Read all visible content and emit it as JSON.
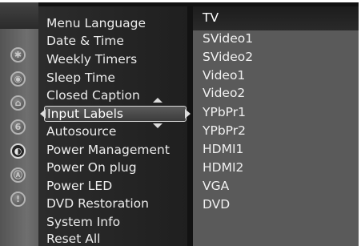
{
  "sidebar": {
    "icons": [
      {
        "name": "settings-icon",
        "glyph": "✱"
      },
      {
        "name": "audio-icon",
        "glyph": "◉"
      },
      {
        "name": "lock-icon",
        "glyph": "⌂"
      },
      {
        "name": "parental-icon",
        "glyph": "6"
      },
      {
        "name": "setup-icon",
        "glyph": "◐"
      },
      {
        "name": "advanced-icon",
        "glyph": "Ⓐ"
      },
      {
        "name": "info-icon",
        "glyph": "!"
      }
    ]
  },
  "menu": {
    "items": [
      "Menu Language",
      "Date & Time",
      "Weekly Timers",
      "Sleep Time",
      "Closed Caption",
      "Input Labels",
      "Autosource",
      "Power Management",
      "Power On plug",
      "Power LED",
      "DVD Restoration",
      "System Info",
      "Reset All"
    ],
    "selected_index": 5
  },
  "submenu": {
    "items": [
      "TV",
      "SVideo1",
      "SVideo2",
      "Video1",
      "Video2",
      "YPbPr1",
      "YPbPr2",
      "HDMI1",
      "HDMI2",
      "VGA",
      "DVD"
    ]
  }
}
